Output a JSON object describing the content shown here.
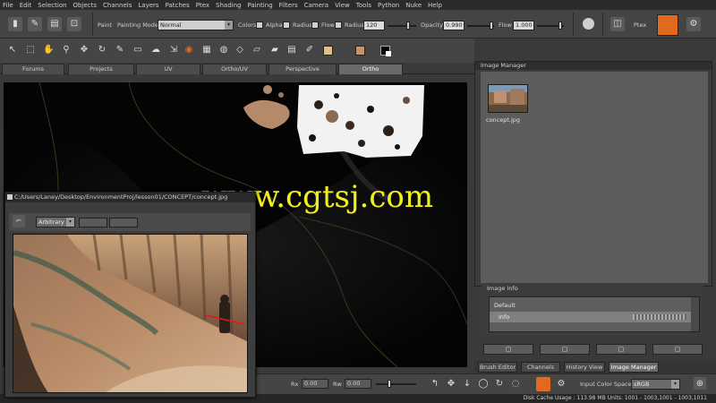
{
  "menu": [
    "File",
    "Edit",
    "Selection",
    "Objects",
    "Channels",
    "Layers",
    "Patches",
    "Ptex",
    "Shading",
    "Painting",
    "Filters",
    "Camera",
    "View",
    "Tools",
    "Python",
    "Nuke",
    "Help"
  ],
  "toolbar": {
    "paint_label": "Paint",
    "mode_label": "Painting Mode",
    "mode_value": "Normal",
    "colors_label": "Colors",
    "alpha_label": "Alpha",
    "radius_label": "Radius",
    "flow_label": "Flow",
    "radius_label2": "Radius",
    "radius_value": "120",
    "opacity_label": "Opacity",
    "opacity_value": "0.990",
    "flow_label2": "Flow",
    "flow_value": "1.000",
    "ptex_label": "Ptex"
  },
  "shelf_tabs": [
    "Forums",
    "Projects",
    "UV",
    "Ortho/UV",
    "Perspective",
    "Ortho"
  ],
  "active_shelf_tab": "Ortho",
  "image_manager": {
    "title": "Image Manager",
    "thumb_name": "concept.jpg"
  },
  "image_info": {
    "title": "Image Info",
    "row1": "Default",
    "row2": "Info"
  },
  "panel_tabs": [
    "Brush Editor",
    "Channels",
    "History View",
    "Image Manager"
  ],
  "active_panel_tab": "Image Manager",
  "bottom": {
    "rb_label": "Rx",
    "rb_value": "0.00",
    "rw_label": "Rw",
    "rw_value": "0.00",
    "color_space_label": "Input Color Space",
    "color_space_value": "sRGB"
  },
  "status": "Disk Cache Usage : 113.98 MB   Units: 1001 - 1003,1001 - 1003,1011",
  "floating_window": {
    "title": "C:/Users/Laney/Desktop/EnvironmentProj/lesson01/CONCEPT/concept.jpg",
    "mode": "Arbitrary"
  },
  "watermark": "www.cgtsj.com",
  "colors": {
    "accent_orange": "#e06a1e",
    "swatch_tan": "#d9c08c",
    "swatch_skin": "#c4946e"
  }
}
